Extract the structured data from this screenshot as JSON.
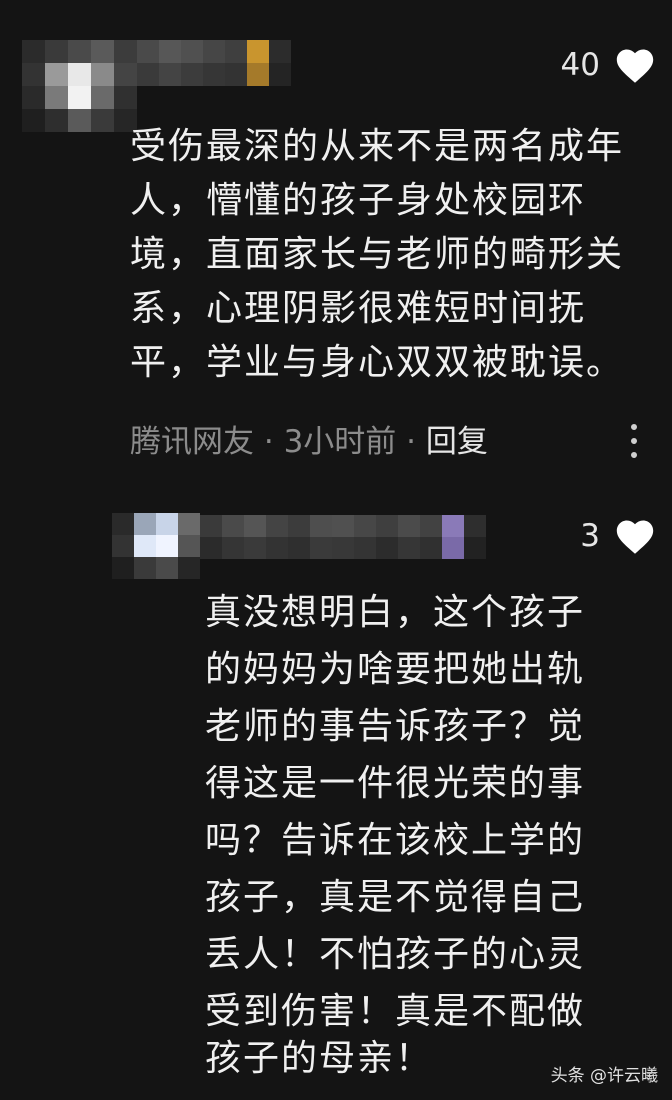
{
  "comments": [
    {
      "likes": "40",
      "text": "受伤最深的从来不是两名成年人，懵懂的孩子身处校园环境，直面家长与老师的畸形关系，心理阴影很难短时间抚平，学业与身心双双被耽误。",
      "lines": [
        "受伤最深的从来不是两名成年",
        "人，懵懂的孩子身处校园环",
        "境，直面家长与老师的畸形关",
        "系，心理阴影很难短时间抚",
        "平，学业与身心双双被耽误。"
      ],
      "author": "腾讯网友",
      "time": "3小时前",
      "reply_label": "回复",
      "separator": "·"
    },
    {
      "likes": "3",
      "lines": [
        "真没想明白，这个孩子",
        "的妈妈为啥要把她出轨",
        "老师的事告诉孩子？觉",
        "得这是一件很光荣的事",
        "吗？告诉在该校上学的",
        "孩子，真是不觉得自己",
        "丢人！不怕孩子的心灵",
        "受到伤害！真是不配做",
        "孩子的母亲！"
      ]
    }
  ],
  "watermark": "头条 @许云曦",
  "icons": {
    "like": "heart-icon",
    "more": "more-vertical-icon"
  },
  "colors": {
    "background": "#141414",
    "text": "#f0f0f0",
    "meta": "#8c8c8c"
  }
}
